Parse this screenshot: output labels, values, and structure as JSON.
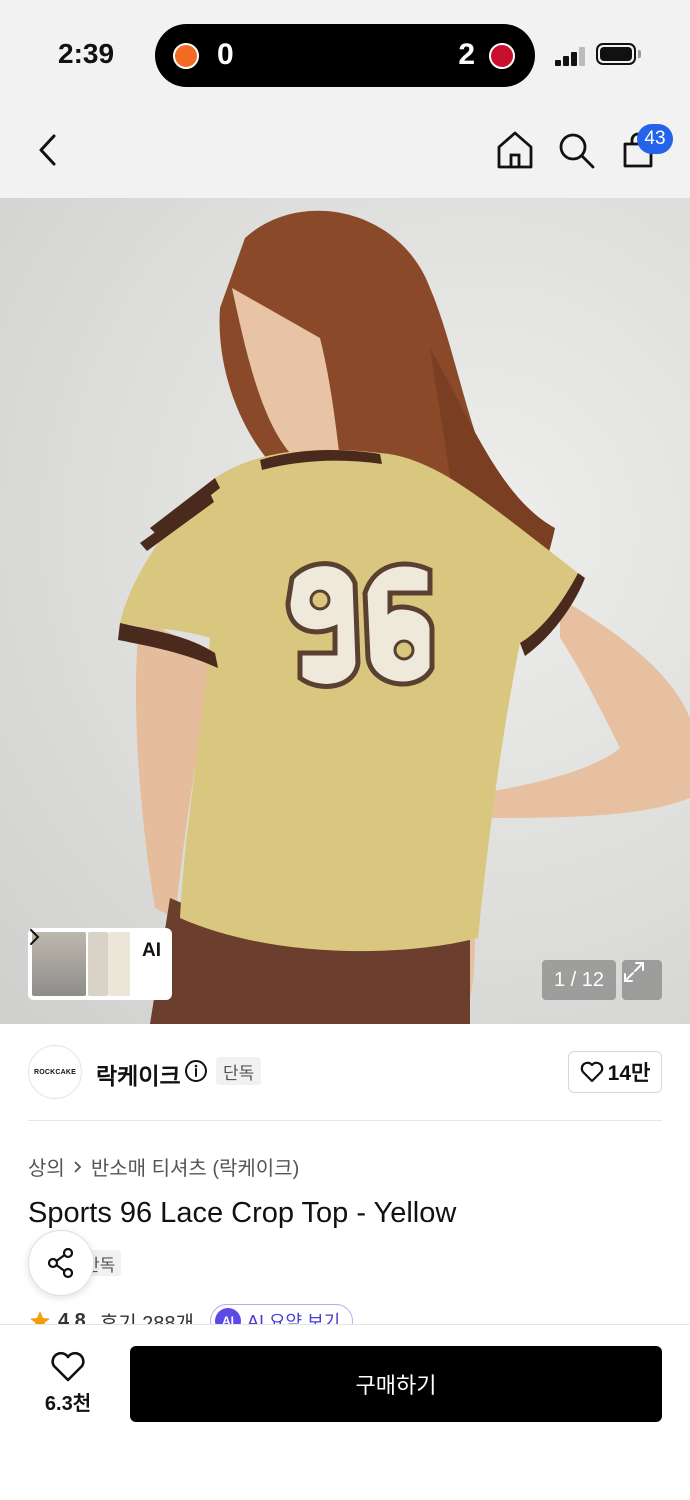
{
  "status_bar": {
    "time": "2:39",
    "live_score": {
      "home_score": "0",
      "away_score": "2"
    },
    "signal_bars_active": 3,
    "battery_percent": 100
  },
  "nav": {
    "icons": [
      "chevron-left-icon",
      "home-icon",
      "search-icon",
      "shopping-bag-icon"
    ],
    "cart_count": "43"
  },
  "gallery": {
    "thumbnail_label": "AI",
    "counter": "1 / 12"
  },
  "brand": {
    "logo_text": "ROCKCAKE",
    "name": "락케이크",
    "tag": "단독",
    "likes": "14만"
  },
  "product": {
    "breadcrumb": [
      "상의",
      "반소매 티셔츠 (락케이크)"
    ],
    "title": "Sports 96 Lace Crop Top - Yellow",
    "tag": "단독",
    "rating": "4.8",
    "reviews": "후기 288개",
    "ai_badge": "AI",
    "ai_summary": "AI 요약 보기"
  },
  "bottom_bar": {
    "wish_count": "6.3천",
    "buy_label": "구매하기"
  },
  "colors": {
    "background": "#f2f2f2",
    "badge": "#2563eb",
    "buy_button": "#000000",
    "rating_star": "#f59e0b",
    "ai_accent": "#5b4ae8"
  }
}
